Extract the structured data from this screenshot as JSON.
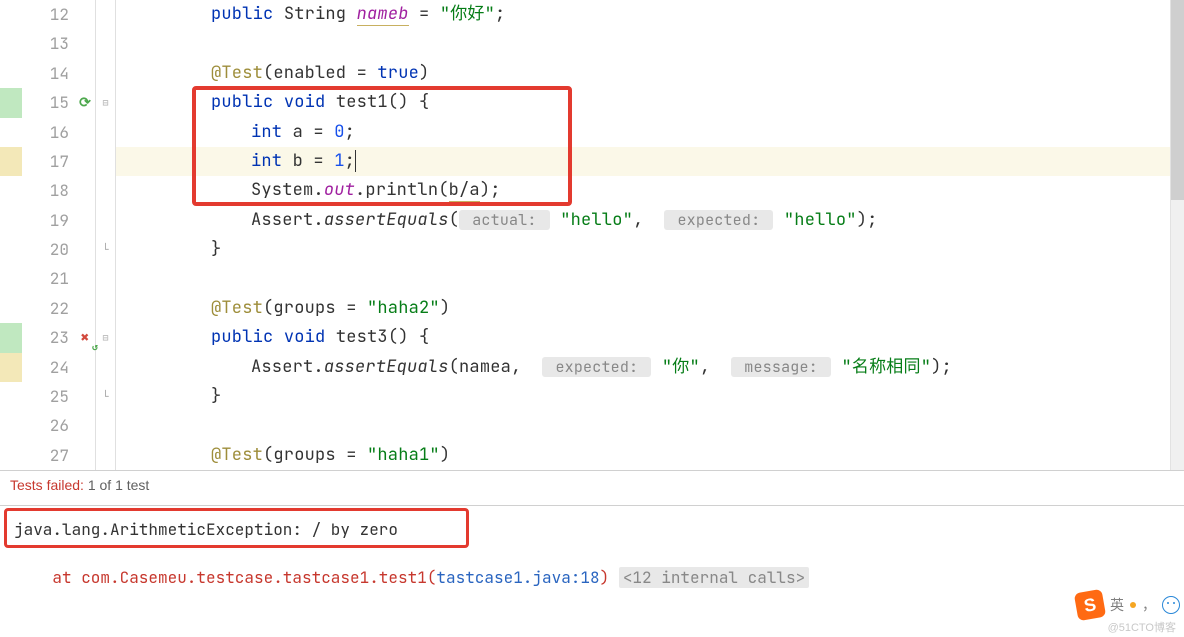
{
  "gutter": {
    "line_numbers": [
      "12",
      "13",
      "14",
      "15",
      "16",
      "17",
      "18",
      "19",
      "20",
      "21",
      "22",
      "23",
      "24",
      "25",
      "26",
      "27"
    ],
    "change_strips": [
      "",
      "",
      "",
      "green",
      "",
      "yellow",
      "",
      "",
      "",
      "",
      "",
      "green",
      "yellow",
      "",
      "",
      ""
    ],
    "run_icons": {
      "15": "run-green",
      "23": "run-red"
    }
  },
  "code": {
    "l12": {
      "kw1": "public",
      "type": "String",
      "field": "nameb",
      "eq": " = ",
      "str": "\"你好\"",
      "end": ";"
    },
    "l14": {
      "ann": "@Test",
      "args": "(enabled = ",
      "val": "true",
      "close": ")"
    },
    "l15": {
      "kw1": "public",
      "kw2": "void",
      "name": "test1",
      "sig": "() {"
    },
    "l16": {
      "kw": "int",
      "rest": " a = ",
      "num": "0",
      "end": ";"
    },
    "l17": {
      "kw": "int",
      "rest": " b = ",
      "num": "1",
      "end": ";"
    },
    "l18": {
      "owner": "System.",
      "field": "out",
      "dot": ".println(",
      "arg": "b/a",
      "close": ");"
    },
    "l19": {
      "owner": "Assert.",
      "mth": "assertEquals",
      "open": "(",
      "hint1": " actual: ",
      "s1": "\"hello\"",
      "comma": ", ",
      "hint2": " expected: ",
      "s2": "\"hello\"",
      "close": ");"
    },
    "l20": {
      "brace": "}"
    },
    "l22": {
      "ann": "@Test",
      "args": "(groups = ",
      "str": "\"haha2\"",
      "close": ")"
    },
    "l23": {
      "kw1": "public",
      "kw2": "void",
      "name": "test3",
      "sig": "() {"
    },
    "l24": {
      "owner": "Assert.",
      "mth": "assertEquals",
      "open": "(",
      "arg1": "namea",
      "comma": ", ",
      "hint1": " expected: ",
      "s1": "\"你\"",
      "comma2": ", ",
      "hint2": " message: ",
      "s2": " \"名称相同\"",
      "close": ");"
    },
    "l25": {
      "brace": "}"
    },
    "l27": {
      "ann": "@Test",
      "args": "(groups = ",
      "str": "\"haha1\"",
      "close": ")"
    }
  },
  "status": {
    "label_fail": "Tests failed:",
    "count": "1",
    "of": "of 1 test"
  },
  "console": {
    "exception": "java.lang.ArithmeticException: / by zero",
    "at": "    at com.Casemeu.testcase.tastcase1.test1(",
    "link": "tastcase1.java:18",
    "close": ") ",
    "omitted": "<12 internal calls>"
  },
  "tray": {
    "ime": "英",
    "comma": "，"
  },
  "watermark": "@51CTO博客"
}
